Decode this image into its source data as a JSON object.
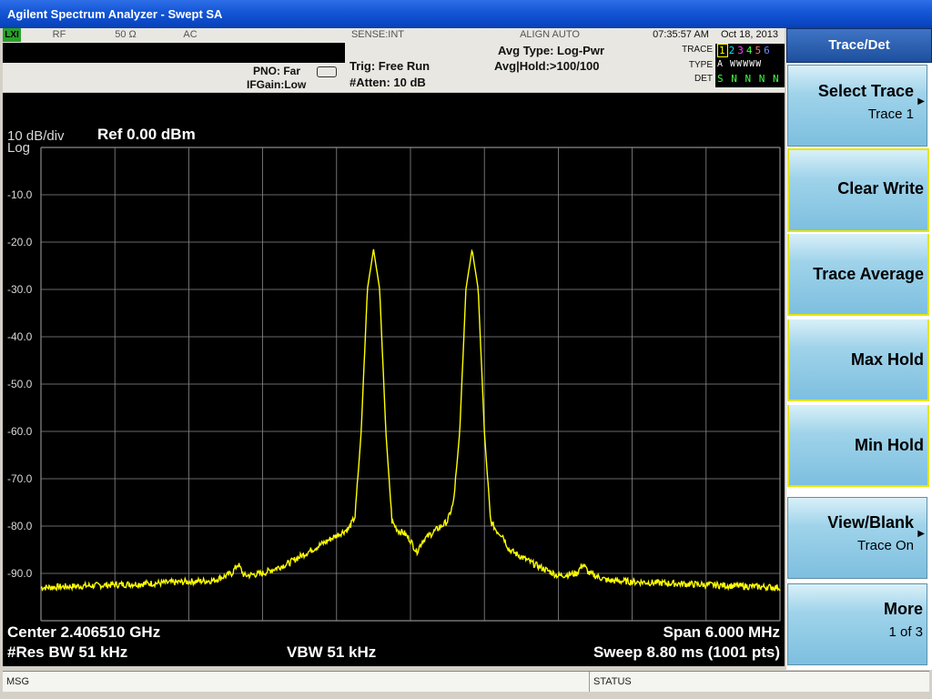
{
  "window": {
    "title": "Agilent Spectrum Analyzer - Swept SA"
  },
  "settings_bar": {
    "lxi": "LXI",
    "input": "RF",
    "impedance": "50 Ω",
    "coupling": "AC",
    "sense": "SENSE:INT",
    "align": "ALIGN AUTO",
    "time": "07:35:57 AM",
    "date": "Oct 18, 2013",
    "pno": "PNO: Far",
    "ifgain": "IFGain:Low",
    "trig": "Trig: Free Run",
    "atten": "#Atten: 10 dB",
    "avg_type": "Avg Type: Log-Pwr",
    "avg_hold": "Avg|Hold:>100/100",
    "trace_label": "TRACE",
    "type_label": "TYPE",
    "det_label": "DET",
    "trace_numbers": [
      "1",
      "2",
      "3",
      "4",
      "5",
      "6"
    ],
    "trace_colors": [
      "#ffff00",
      "#00e5ff",
      "#ff40ff",
      "#40ff40",
      "#ff6a6a",
      "#6a8cff"
    ],
    "trace_type": "A WWWWW",
    "trace_det": "S N N N N N"
  },
  "graph": {
    "scale": "10 dB/div",
    "scale_type": "Log",
    "ref_level": "Ref 0.00 dBm",
    "y_tick_labels": [
      "-10.0",
      "-20.0",
      "-30.0",
      "-40.0",
      "-50.0",
      "-60.0",
      "-70.0",
      "-80.0",
      "-90.0"
    ],
    "center": "Center 2.406510 GHz",
    "rbw": "#Res BW 51 kHz",
    "vbw": "VBW 51 kHz",
    "span": "Span 6.000 MHz",
    "sweep": "Sweep  8.80 ms (1001 pts)",
    "trace_color": "#ffff00"
  },
  "chart_data": {
    "type": "line",
    "x_unit": "MHz offset from center",
    "y_unit": "dBm",
    "xlim": [
      -3.0,
      3.0
    ],
    "ylim": [
      -100,
      0
    ],
    "grid": true,
    "series": [
      {
        "x": [
          -3.0,
          -2.5,
          -2.0,
          -1.6,
          -1.45,
          -1.4,
          -1.35,
          -1.2,
          -1.0,
          -0.8,
          -0.6,
          -0.5,
          -0.45,
          -0.4,
          -0.35,
          -0.3,
          -0.25,
          -0.2,
          -0.15,
          -0.1,
          -0.05,
          0.0,
          0.05,
          0.1,
          0.2,
          0.3,
          0.35,
          0.4,
          0.45,
          0.5,
          0.55,
          0.6,
          0.65,
          0.7,
          0.75,
          0.8,
          1.0,
          1.2,
          1.35,
          1.4,
          1.45,
          1.6,
          2.0,
          2.5,
          3.0
        ],
        "y": [
          -93,
          -92.5,
          -92,
          -91.5,
          -90,
          -88,
          -90.5,
          -90,
          -88,
          -85,
          -82,
          -80.5,
          -78,
          -60,
          -30,
          -21.5,
          -30,
          -60,
          -79,
          -81,
          -81.5,
          -83,
          -85.5,
          -83,
          -81,
          -79,
          -75,
          -60,
          -30,
          -21.5,
          -30,
          -60,
          -79,
          -81,
          -82,
          -85,
          -88,
          -90.5,
          -90,
          -88,
          -90,
          -91.5,
          -92,
          -92.5,
          -93
        ]
      }
    ]
  },
  "softkeys": {
    "title": "Trace/Det",
    "select_trace": "Select Trace",
    "select_trace_value": "Trace 1",
    "clear_write": "Clear Write",
    "trace_average": "Trace Average",
    "max_hold": "Max Hold",
    "min_hold": "Min Hold",
    "view_blank": "View/Blank",
    "view_blank_value": "Trace On",
    "more": "More",
    "more_page": "1 of 3"
  },
  "status_bar": {
    "msg": "MSG",
    "status": "STATUS"
  }
}
